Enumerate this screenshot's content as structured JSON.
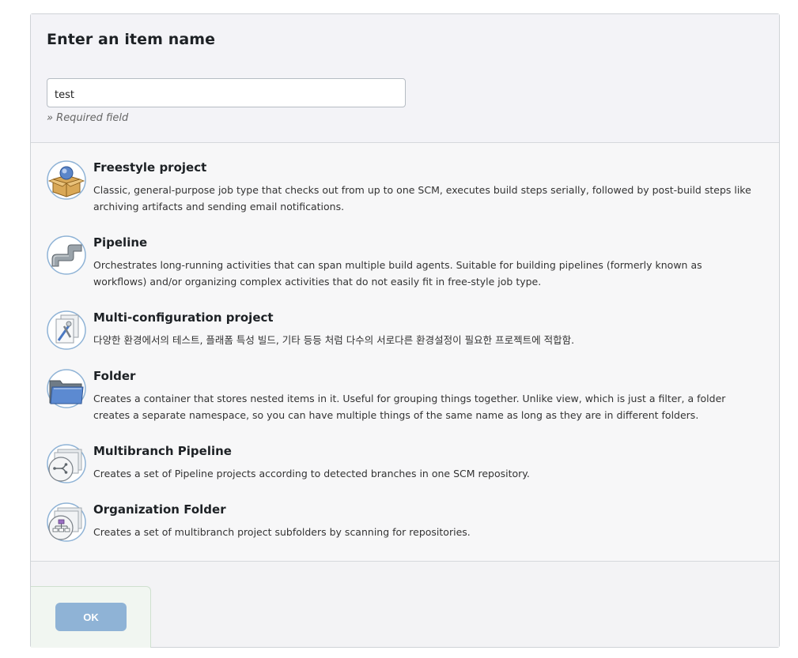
{
  "header": {
    "title": "Enter an item name",
    "item_name_value": "test",
    "required_note": "» Required field"
  },
  "items": [
    {
      "title": "Freestyle project",
      "icon": "freestyle-project-icon",
      "description": "Classic, general-purpose job type that checks out from up to one SCM, executes build steps serially, followed by post-build steps like archiving artifacts and sending email notifications."
    },
    {
      "title": "Pipeline",
      "icon": "pipeline-icon",
      "description": "Orchestrates long-running activities that can span multiple build agents. Suitable for building pipelines (formerly known as workflows) and/or organizing complex activities that do not easily fit in free-style job type."
    },
    {
      "title": "Multi-configuration project",
      "icon": "multi-configuration-icon",
      "description": "다양한 환경에서의 테스트, 플래폼 특성 빌드, 기타 등등 처럼 다수의 서로다른 환경설정이 필요한 프로젝트에 적합함."
    },
    {
      "title": "Folder",
      "icon": "folder-icon",
      "description": "Creates a container that stores nested items in it. Useful for grouping things together. Unlike view, which is just a filter, a folder creates a separate namespace, so you can have multiple things of the same name as long as they are in different folders."
    },
    {
      "title": "Multibranch Pipeline",
      "icon": "multibranch-pipeline-icon",
      "description": "Creates a set of Pipeline projects according to detected branches in one SCM repository."
    },
    {
      "title": "Organization Folder",
      "icon": "organization-folder-icon",
      "description": "Creates a set of multibranch project subfolders by scanning for repositories."
    }
  ],
  "footer": {
    "ok_label": "OK"
  }
}
